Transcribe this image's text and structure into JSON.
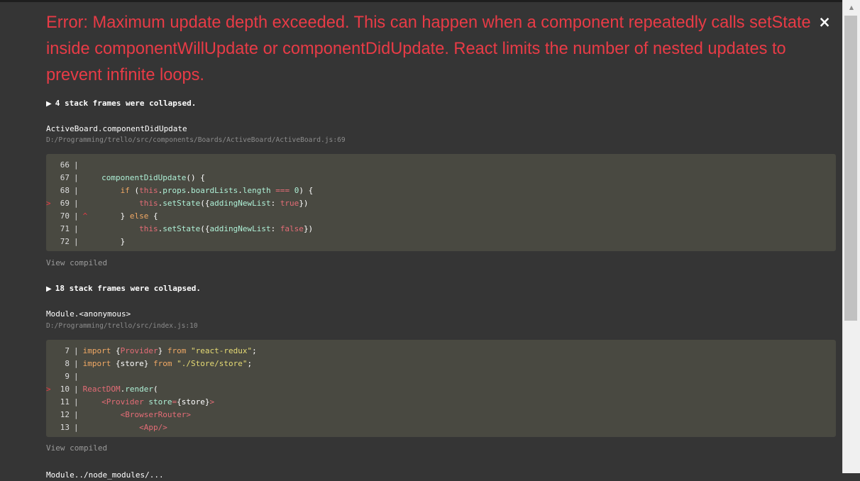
{
  "overlay": {
    "error_message": "Error: Maximum update depth exceeded. This can happen when a component repeatedly calls setState inside componentWillUpdate or componentDidUpdate. React limits the number of nested updates to prevent infinite loops.",
    "close_icon": "×",
    "colors": {
      "background": "#353535",
      "error": "#e83b46",
      "code_background": "#494941"
    }
  },
  "collapsed_1": {
    "icon": "▶",
    "label": "4 stack frames were collapsed."
  },
  "frame_1": {
    "function": "ActiveBoard.componentDidUpdate",
    "path": "D:/Programming/trello/src/components/Boards/ActiveBoard/ActiveBoard.js:69",
    "lines": [
      {
        "num": "66",
        "marker": "",
        "caret": "",
        "code": ""
      },
      {
        "num": "67",
        "marker": "",
        "caret": "",
        "code": "    componentDidUpdate() {"
      },
      {
        "num": "68",
        "marker": "",
        "caret": "",
        "code": "        if (this.props.boardLists.length === 0) {"
      },
      {
        "num": "69",
        "marker": ">",
        "caret": "",
        "code": "            this.setState({addingNewList: true})"
      },
      {
        "num": "70",
        "marker": "",
        "caret": "^",
        "code": "        } else {"
      },
      {
        "num": "71",
        "marker": "",
        "caret": "",
        "code": "            this.setState({addingNewList: false})"
      },
      {
        "num": "72",
        "marker": "",
        "caret": "",
        "code": "        }"
      }
    ],
    "view_compiled": "View compiled"
  },
  "collapsed_2": {
    "icon": "▶",
    "label": "18 stack frames were collapsed."
  },
  "frame_2": {
    "function": "Module.<anonymous>",
    "path": "D:/Programming/trello/src/index.js:10",
    "lines": [
      {
        "num": "7",
        "marker": "",
        "caret": "",
        "code": "import {Provider} from \"react-redux\";"
      },
      {
        "num": "8",
        "marker": "",
        "caret": "",
        "code": "import {store} from \"./Store/store\";"
      },
      {
        "num": "9",
        "marker": "",
        "caret": "",
        "code": ""
      },
      {
        "num": "10",
        "marker": ">",
        "caret": "",
        "code": "ReactDOM.render("
      },
      {
        "num": "11",
        "marker": "",
        "caret": "",
        "code": "    <Provider store={store}>"
      },
      {
        "num": "12",
        "marker": "",
        "caret": "",
        "code": "        <BrowserRouter>"
      },
      {
        "num": "13",
        "marker": "",
        "caret": "",
        "code": "            <App/>"
      }
    ],
    "view_compiled": "View compiled"
  },
  "next_frame_partial": "Module../node_modules/..."
}
